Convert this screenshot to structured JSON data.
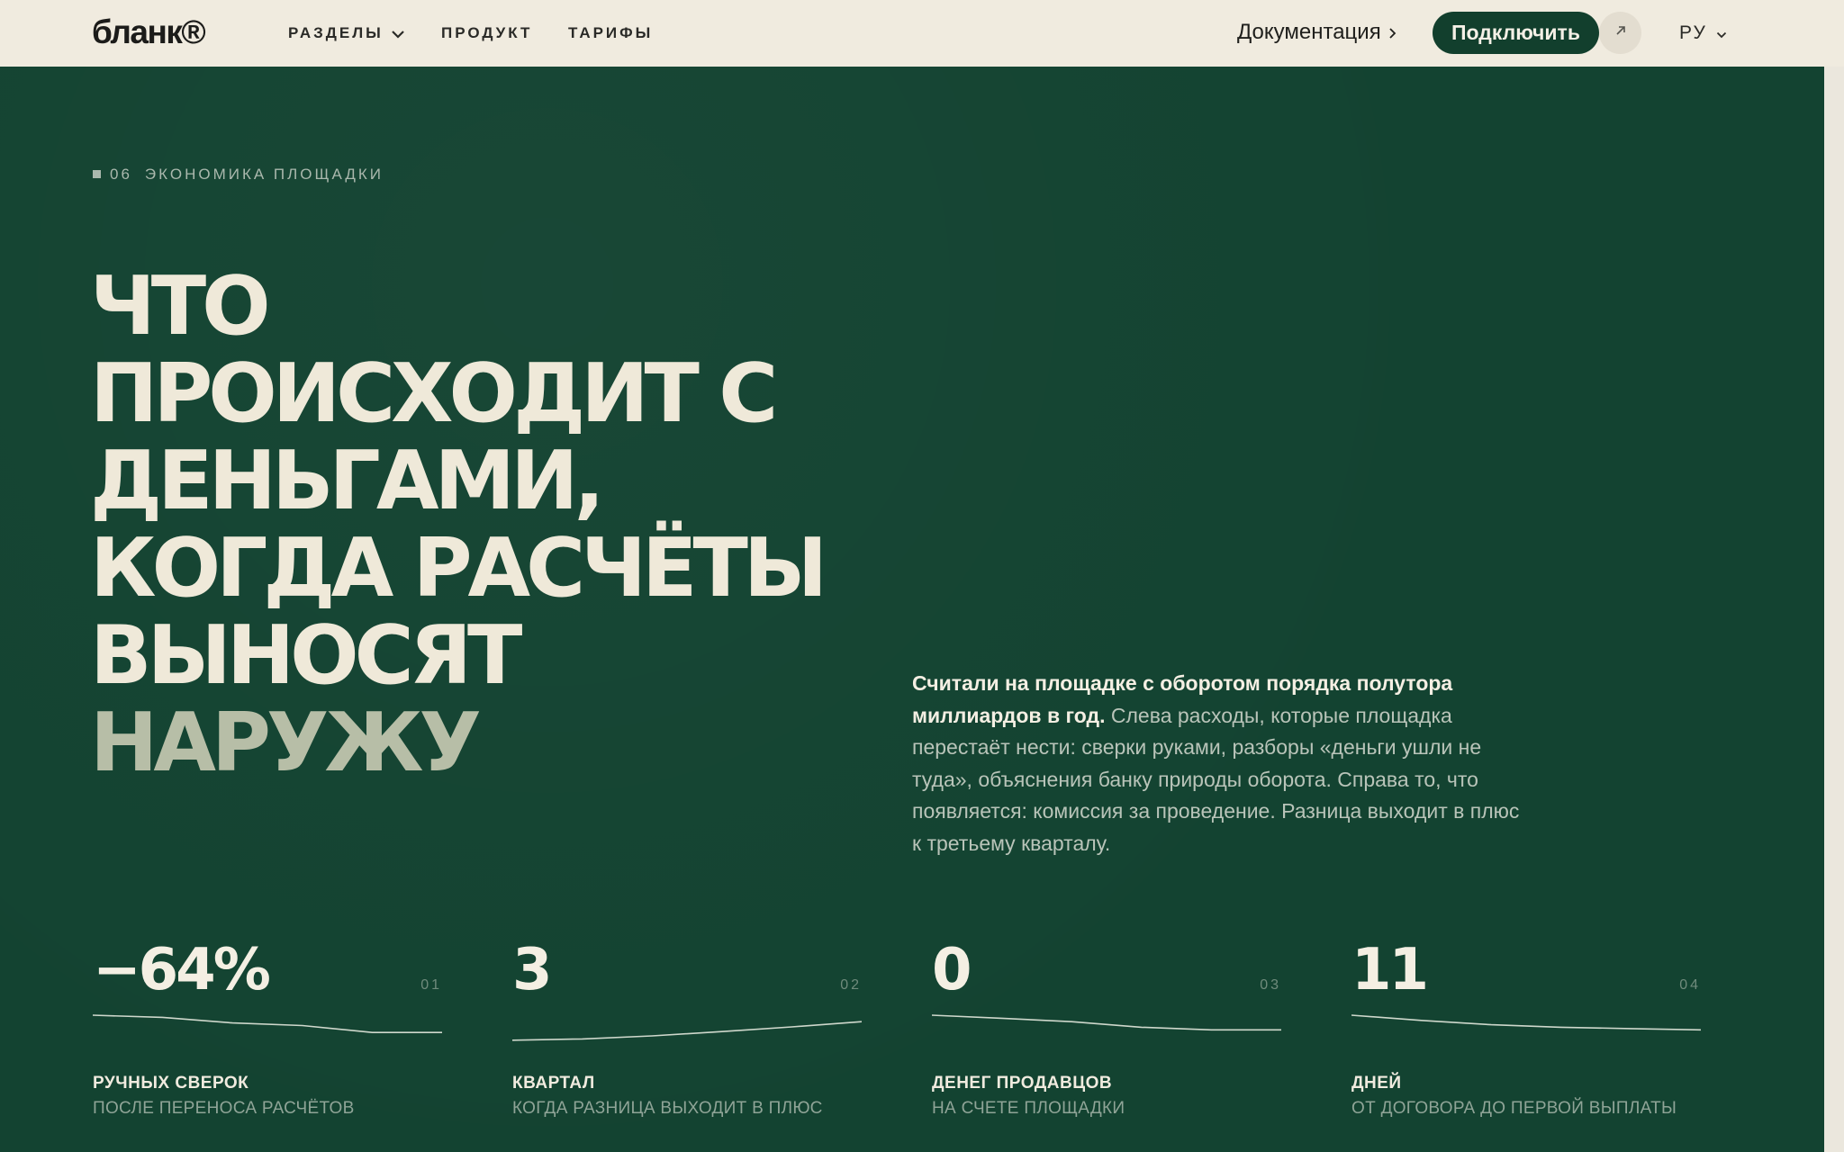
{
  "brand": {
    "name": "бланк®"
  },
  "nav": {
    "sections": "РАЗДЕЛЫ",
    "product": "ПРОДУКТ",
    "pricing": "ТАРИФЫ",
    "docs": "Документация",
    "connect": "Подключить",
    "lang": "РУ"
  },
  "section": {
    "number": "06",
    "name": "ЭКОНОМИКА ПЛОЩАДКИ"
  },
  "headline": {
    "lines": [
      "ЧТО",
      "ПРОИСХОДИТ С",
      "ДЕНЬГАМИ,",
      "КОГДА РАСЧЁТЫ",
      "ВЫНОСЯТ"
    ],
    "last": "НАРУЖУ"
  },
  "lead": {
    "strong": "Считали на площадке с оборотом порядка полутора миллиардов в год.",
    "rest": " Слева расходы, которые площадка перестаёт нести: сверки руками, разборы «деньги ушли не туда», объяснения банку природы оборота. Справа то, что появляется: комиссия за проведение. Разница выходит в плюс к третьему кварталу."
  },
  "stats": [
    {
      "value": "−64%",
      "index": "01",
      "label": "РУЧНЫХ СВЕРОК",
      "sub": "ПОСЛЕ ПЕРЕНОСА РАСЧЁТОВ",
      "trend": [
        1.0,
        0.95,
        0.82,
        0.76,
        0.6,
        0.6
      ]
    },
    {
      "value": "3",
      "index": "02",
      "label": "КВАРТАЛ",
      "sub": "КОГДА РАЗНИЦА ВЫХОДИТ В ПЛЮС",
      "trend": [
        0.42,
        0.45,
        0.52,
        0.62,
        0.73,
        0.85
      ]
    },
    {
      "value": "0",
      "index": "03",
      "label": "ДЕНЕГ ПРОДАВЦОВ",
      "sub": "НА СЧЕТЕ ПЛОЩАДКИ",
      "trend": [
        1.0,
        0.93,
        0.85,
        0.72,
        0.66,
        0.66
      ]
    },
    {
      "value": "11",
      "index": "04",
      "label": "ДНЕЙ",
      "sub": "ОТ ДОГОВОРА ДО ПЕРВОЙ ВЫПЛАТЫ",
      "trend": [
        1.0,
        0.88,
        0.78,
        0.72,
        0.69,
        0.66
      ]
    }
  ],
  "colors": {
    "background": "#134331",
    "cream": "#efe9d9",
    "accent_button": "#123f2d",
    "line": "#cfd8cc"
  }
}
